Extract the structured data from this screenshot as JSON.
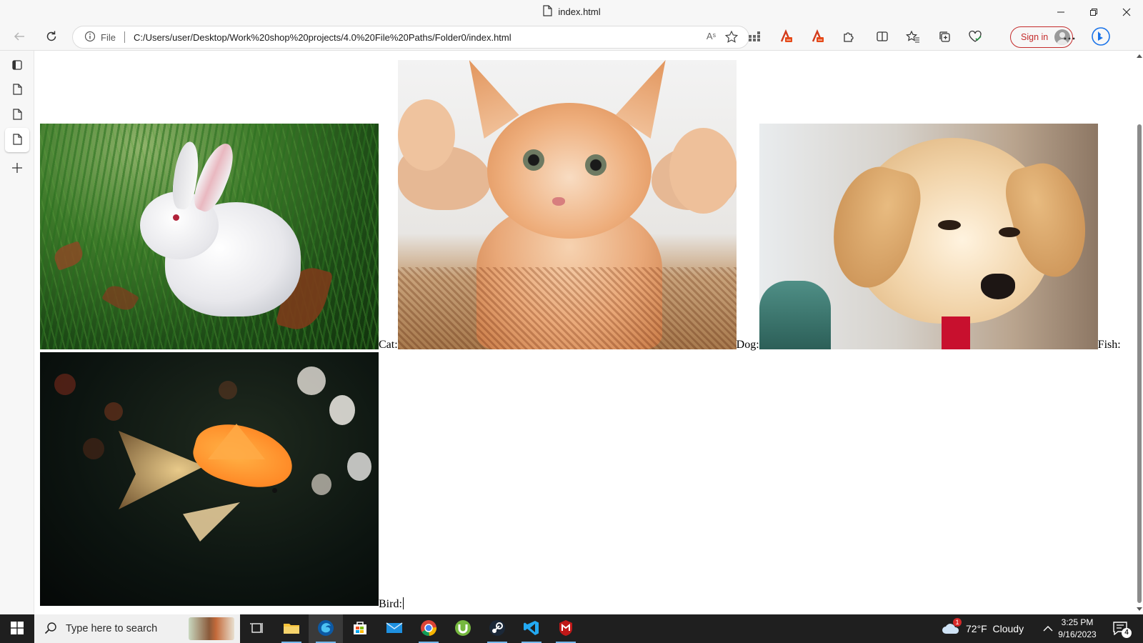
{
  "window": {
    "tab_title": "index.html"
  },
  "toolbar": {
    "scheme": "File",
    "url": "C:/Users/user/Desktop/Work%20shop%20projects/4.0%20File%20Paths/Folder0/index.html",
    "read_aloud": "Aˢ",
    "sign_in": "Sign in"
  },
  "page": {
    "labels": {
      "cat": "Cat:",
      "dog": "Dog:",
      "fish": "Fish:",
      "bird": "Bird:"
    }
  },
  "taskbar": {
    "search_placeholder": "Type here to search",
    "weather": "72°F  Cloudy",
    "weather_badge": "1",
    "time": "3:25 PM",
    "date": "9/16/2023",
    "notifications": "4"
  },
  "colors": {
    "signin_accent": "#c42b2b",
    "edge_blue": "#0c59a4",
    "taskbar": "#1f1f1f"
  }
}
